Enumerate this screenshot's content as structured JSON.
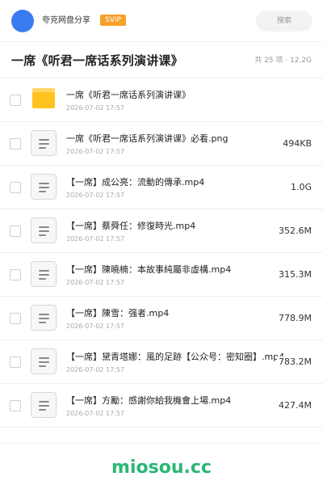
{
  "header": {
    "app_name": "夸克网盘分享",
    "badge": "SVIP",
    "search_placeholder": "搜索",
    "avatar_color": "#3a7cf0"
  },
  "folder": {
    "title": "一席《听君一席话系列演讲课》",
    "meta": "共 25 项 · 12.2G"
  },
  "files": [
    {
      "icon": "folder-icon",
      "name": "一席《听君一席话系列演讲课》",
      "date": "2026-07-02 17:57",
      "size": ""
    },
    {
      "icon": "document-icon",
      "name": "一席《听君一席话系列演讲课》必看.png",
      "date": "2026-07-02 17:57",
      "size": "494KB"
    },
    {
      "icon": "document-icon",
      "name": "【一席】成公亮：流動的傳承.mp4",
      "date": "2026-07-02 17:57",
      "size": "1.0G"
    },
    {
      "icon": "document-icon",
      "name": "【一席】蔡舜任：修復時光.mp4",
      "date": "2026-07-02 17:57",
      "size": "352.6M"
    },
    {
      "icon": "document-icon",
      "name": "【一席】陳曉楠：本故事純屬非虛構.mp4",
      "date": "2026-07-02 17:57",
      "size": "315.3M"
    },
    {
      "icon": "document-icon",
      "name": "【一席】陳雪：强者.mp4",
      "date": "2026-07-02 17:57",
      "size": "778.9M"
    },
    {
      "icon": "document-icon",
      "name": "【一席】黛青塔娜：風的足跡【公众号：密知圈】.mp4",
      "date": "2026-07-02 17:57",
      "size": "783.2M"
    },
    {
      "icon": "document-icon",
      "name": "【一席】方勵：感謝你給我機會上場.mp4",
      "date": "2026-07-02 17:57",
      "size": "427.4M"
    }
  ],
  "watermark": "miosou.cc",
  "colors": {
    "badge": "#f7a12b",
    "folder": "#ffc21f",
    "watermark": "#2bb673"
  }
}
